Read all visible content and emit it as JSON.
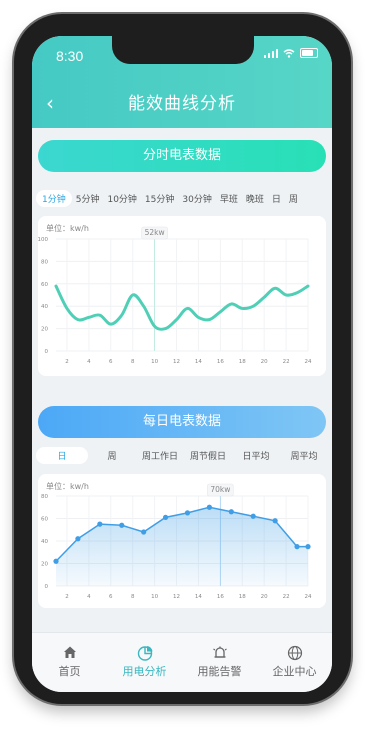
{
  "status": {
    "time": "8:30"
  },
  "nav": {
    "back": "‹",
    "title": "能效曲线分析"
  },
  "section1": {
    "title": "分时电表数据",
    "tabs": [
      "1分钟",
      "5分钟",
      "10分钟",
      "15分钟",
      "30分钟",
      "早班",
      "晚班",
      "日",
      "周"
    ],
    "active_tab": 0,
    "unit": "单位：kw/h",
    "chart_data": {
      "type": "line",
      "x": [
        2,
        4,
        6,
        8,
        10,
        12,
        14,
        16,
        18,
        20,
        22,
        24
      ],
      "x_points": [
        1,
        2,
        3,
        4,
        5,
        6,
        7,
        8,
        9,
        10,
        11,
        12,
        13,
        14,
        15,
        16,
        17,
        18,
        19,
        20,
        21,
        22,
        23,
        24
      ],
      "values": [
        58,
        38,
        28,
        30,
        32,
        24,
        32,
        50,
        40,
        22,
        20,
        28,
        38,
        30,
        28,
        35,
        42,
        38,
        40,
        48,
        56,
        50,
        52,
        58
      ],
      "ylim": [
        0,
        100
      ],
      "yticks": [
        0,
        20,
        40,
        60,
        80,
        100
      ],
      "highlight": {
        "x": 10,
        "label": "52kw"
      },
      "color": "#4fcfb6"
    }
  },
  "section2": {
    "title": "每日电表数据",
    "tabs": [
      "日",
      "周",
      "周工作日",
      "周节假日",
      "日平均",
      "周平均"
    ],
    "active_tab": 0,
    "unit": "单位：kw/h",
    "chart_data": {
      "type": "area",
      "x": [
        2,
        4,
        6,
        8,
        10,
        12,
        14,
        16,
        18,
        20,
        22,
        24
      ],
      "x_points": [
        1,
        3,
        5,
        7,
        9,
        11,
        13,
        15,
        17,
        19,
        21,
        23,
        24
      ],
      "values": [
        22,
        42,
        55,
        54,
        48,
        61,
        65,
        70,
        66,
        62,
        58,
        35,
        35
      ],
      "ylim": [
        0,
        80
      ],
      "yticks": [
        0,
        20,
        40,
        60,
        80
      ],
      "highlight": {
        "x": 16,
        "label": "70kw"
      },
      "color": "#3f9ee6"
    }
  },
  "tabbar": [
    {
      "label": "首页",
      "icon": "home-icon"
    },
    {
      "label": "用电分析",
      "icon": "pie-chart-icon"
    },
    {
      "label": "用能告警",
      "icon": "bell-icon"
    },
    {
      "label": "企业中心",
      "icon": "globe-icon"
    }
  ],
  "tabbar_active": 1
}
